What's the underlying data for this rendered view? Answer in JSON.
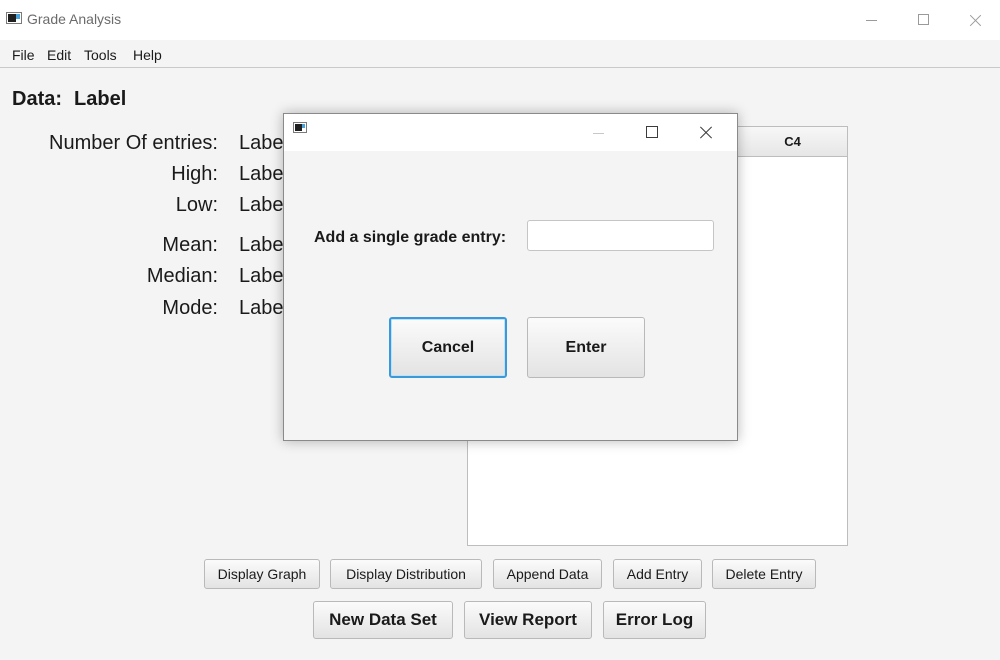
{
  "window": {
    "title": "Grade Analysis"
  },
  "menu": [
    "File",
    "Edit",
    "Tools",
    "Help"
  ],
  "data_heading": {
    "label": "Data:",
    "value": "Label"
  },
  "stats": [
    {
      "label": "Number Of entries:",
      "value": "Labe"
    },
    {
      "label": "High:",
      "value": "Labe"
    },
    {
      "label": "Low:",
      "value": "Labe"
    },
    {
      "label": "Mean:",
      "value": "Labe"
    },
    {
      "label": "Median:",
      "value": "Labe"
    },
    {
      "label": "Mode:",
      "value": "Labe"
    }
  ],
  "table": {
    "columns": [
      "C4"
    ]
  },
  "buttons": {
    "display_graph": "Display Graph",
    "display_distribution": "Display Distribution",
    "append_data": "Append Data",
    "add_entry": "Add Entry",
    "delete_entry": "Delete Entry",
    "new_data_set": "New Data Set",
    "view_report": "View Report",
    "error_log": "Error Log"
  },
  "dialog": {
    "title": "",
    "prompt": "Add a single grade entry:",
    "input_value": "",
    "cancel_label": "Cancel",
    "enter_label": "Enter"
  },
  "colors": {
    "focus_accent": "#3a9ad9",
    "window_background": "#f4f4f4"
  }
}
